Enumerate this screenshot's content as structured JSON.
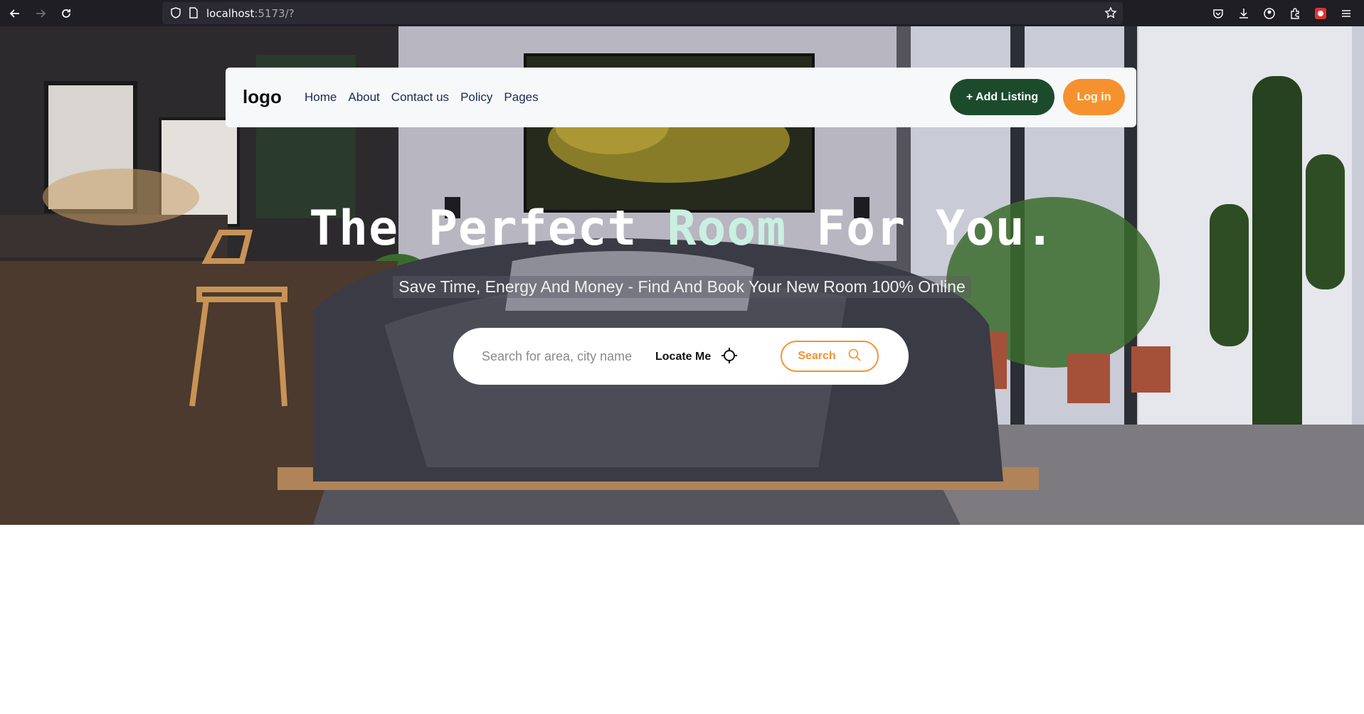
{
  "browser": {
    "url_host": "localhost",
    "url_rest": ":5173/?"
  },
  "navbar": {
    "logo": "logo",
    "links": [
      "Home",
      "About",
      "Contact us",
      "Policy",
      "Pages"
    ],
    "add_listing": "+ Add Listing",
    "login": "Log in"
  },
  "hero": {
    "title_part1": "The Perfect ",
    "title_accent": "Room",
    "title_part2": " For You.",
    "subtitle": "Save Time, Energy And Money - Find And Book Your New Room 100% Online"
  },
  "search": {
    "placeholder": "Search for area, city name",
    "locate_label": "Locate Me",
    "button_label": "Search"
  },
  "colors": {
    "brand_green": "#1c4b2c",
    "brand_orange": "#f5922f",
    "title_accent": "#c9f0e0"
  },
  "icons": [
    "back-icon",
    "forward-icon",
    "reload-icon",
    "shield-icon",
    "page-icon",
    "star-icon",
    "pocket-icon",
    "download-icon",
    "account-icon",
    "extensions-icon",
    "profile-extension-icon",
    "menu-icon",
    "crosshair-icon",
    "search-icon"
  ]
}
